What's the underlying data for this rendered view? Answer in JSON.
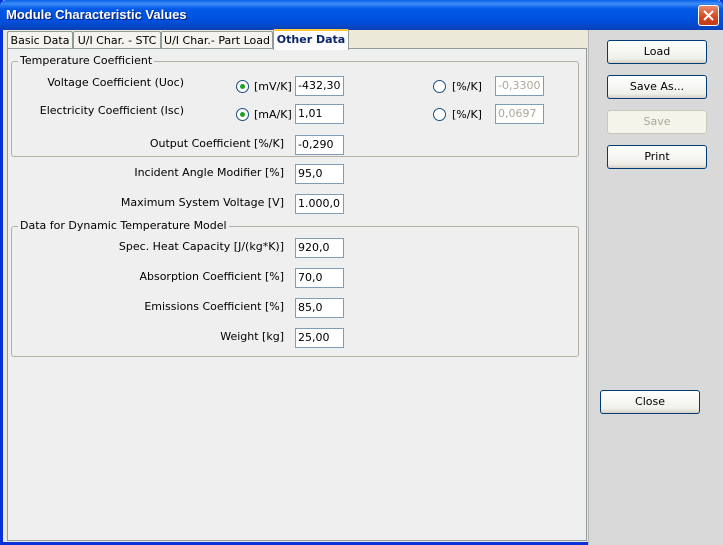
{
  "window": {
    "title": "Module Characteristic Values"
  },
  "tabs": [
    {
      "label": "Basic Data"
    },
    {
      "label": "U/I Char. - STC"
    },
    {
      "label": "U/I Char.- Part Load"
    },
    {
      "label": "Other Data"
    }
  ],
  "temp_coeff": {
    "title": "Temperature Coefficient",
    "voltage": {
      "label": "Voltage Coefficient (Uoc)",
      "unit1": "[mV/K]",
      "value1": "-432,30",
      "unit2": "[%/K]",
      "value2": "-0,3300"
    },
    "current": {
      "label": "Electricity Coefficient (Isc)",
      "unit1": "[mA/K]",
      "value1": "1,01",
      "unit2": "[%/K]",
      "value2": "0,0697"
    },
    "output": {
      "label": "Output Coefficient [%/K]",
      "value": "-0,290"
    }
  },
  "incident": {
    "label": "Incident Angle Modifier [%]",
    "value": "95,0"
  },
  "max_voltage": {
    "label": "Maximum System Voltage [V]",
    "value": "1.000,0"
  },
  "dynamic": {
    "title": "Data for Dynamic Temperature Model",
    "heat": {
      "label": "Spec. Heat Capacity [J/(kg*K)]",
      "value": "920,0"
    },
    "absorption": {
      "label": "Absorption Coefficient [%]",
      "value": "70,0"
    },
    "emissions": {
      "label": "Emissions Coefficient [%]",
      "value": "85,0"
    },
    "weight": {
      "label": "Weight [kg]",
      "value": "25,00"
    }
  },
  "buttons": {
    "load": "Load",
    "save_as": "Save As...",
    "save": "Save",
    "print": "Print",
    "close": "Close"
  }
}
